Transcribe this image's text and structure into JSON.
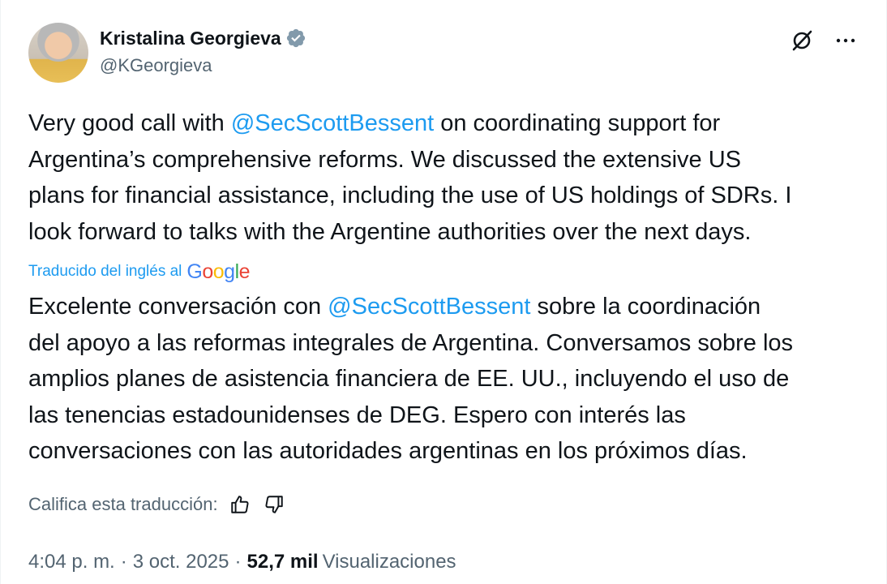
{
  "author": {
    "name": "Kristalina Georgieva",
    "handle": "@KGeorgieva",
    "verified_icon": "verified-badge-icon"
  },
  "icons": {
    "grok": "grok-icon",
    "more": "more-options-icon",
    "thumbs_up": "thumbs-up-icon",
    "thumbs_down": "thumbs-down-icon"
  },
  "tweet": {
    "original": {
      "l1_a": "Very good call with ",
      "l1_mention": "@SecScottBessent",
      "l1_b": " on coordinating support for",
      "l2": "Argentina’s comprehensive reforms.  We discussed the extensive US",
      "l3": "plans for financial assistance, including the use of US holdings of SDRs. I",
      "l4": "look forward to talks with the Argentine authorities over the next days."
    },
    "translated_label": "Traducido del inglés al",
    "google": [
      "G",
      "o",
      "o",
      "g",
      "l",
      "e"
    ],
    "translation": {
      "l1_a": "Excelente conversación con ",
      "l1_mention": "@SecScottBessent",
      "l1_b": " sobre la coordinación",
      "l2": "del apoyo a las reformas integrales de Argentina. Conversamos sobre los",
      "l3": "amplios planes de asistencia financiera de EE. UU., incluyendo el uso de",
      "l4": "las tenencias estadounidenses de DEG. Espero con interés las",
      "l5": "conversaciones con las autoridades argentinas en los próximos días."
    }
  },
  "rating": {
    "label": "Califica esta traducción:"
  },
  "meta": {
    "time": "4:04 p. m.",
    "separator": "·",
    "date": "3 oct. 2025",
    "views_count": "52,7 mil",
    "views_label": "Visualizaciones"
  },
  "colors": {
    "mention": "#1d9bf0",
    "secondary_text": "#536471",
    "primary_text": "#0f1419",
    "verified": "#829aab"
  }
}
